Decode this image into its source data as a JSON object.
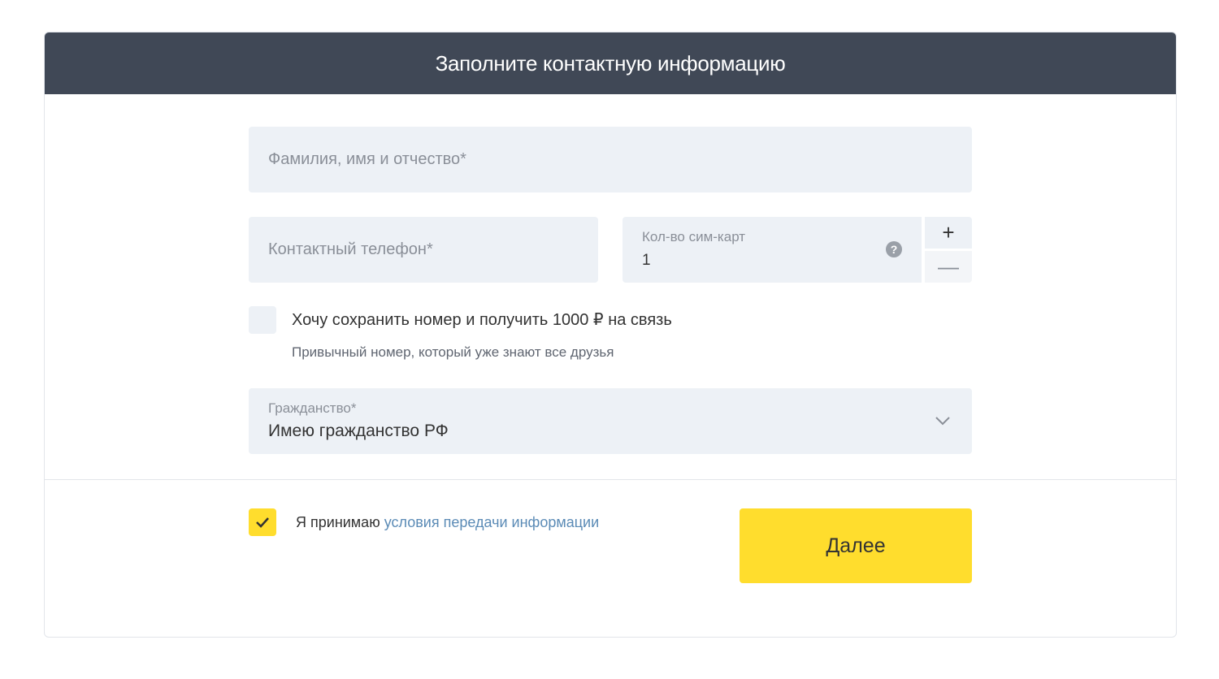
{
  "header": {
    "title": "Заполните контактную информацию"
  },
  "form": {
    "full_name": {
      "placeholder": "Фамилия, имя и отчество*",
      "value": ""
    },
    "phone": {
      "placeholder": "Контактный телефон*",
      "value": ""
    },
    "sim_count": {
      "label": "Кол-во сим-карт",
      "value": "1",
      "help_icon": "question-circle-icon",
      "increment_label": "+",
      "decrement_label": "—"
    },
    "keep_number": {
      "checked": false,
      "label": "Хочу сохранить номер и получить 1000 ₽ на связь",
      "hint": "Привычный номер, который уже знают все друзья"
    },
    "citizenship": {
      "label": "Гражданство*",
      "value": "Имею гражданство РФ",
      "icon": "chevron-down-icon"
    }
  },
  "footer": {
    "accept": {
      "checked": true,
      "text": "Я принимаю",
      "link_text": "условия передачи информации"
    },
    "next_label": "Далее"
  },
  "colors": {
    "header_bg": "#404856",
    "field_bg": "#edf1f6",
    "accent_yellow": "#ffdd2d",
    "link": "#5b8bb6"
  }
}
